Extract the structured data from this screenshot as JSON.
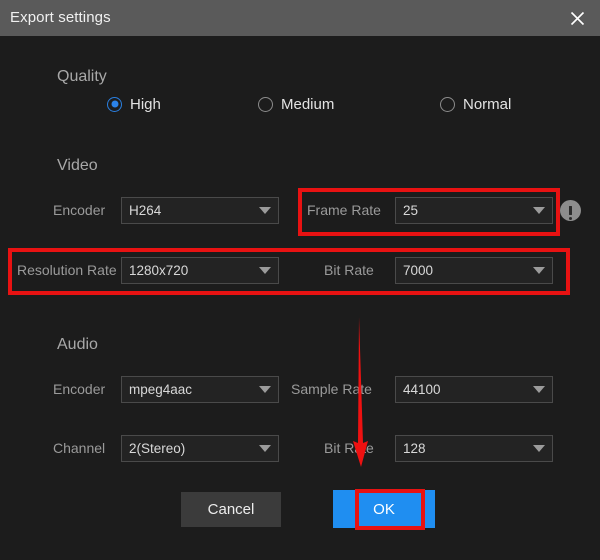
{
  "titlebar": {
    "title": "Export settings",
    "close_icon": "close-icon"
  },
  "quality": {
    "heading": "Quality",
    "options": [
      {
        "label": "High",
        "selected": true
      },
      {
        "label": "Medium",
        "selected": false
      },
      {
        "label": "Normal",
        "selected": false
      }
    ]
  },
  "video": {
    "heading": "Video",
    "encoder": {
      "label": "Encoder",
      "value": "H264"
    },
    "frame_rate": {
      "label": "Frame Rate",
      "value": "25"
    },
    "resolution_rate": {
      "label": "Resolution Rate",
      "value": "1280x720"
    },
    "bit_rate": {
      "label": "Bit Rate",
      "value": "7000"
    },
    "info_icon": "info-exclamation-icon"
  },
  "audio": {
    "heading": "Audio",
    "encoder": {
      "label": "Encoder",
      "value": "mpeg4aac"
    },
    "sample_rate": {
      "label": "Sample Rate",
      "value": "44100"
    },
    "channel": {
      "label": "Channel",
      "value": "2(Stereo)"
    },
    "bit_rate": {
      "label": "Bit Rate",
      "value": "128"
    }
  },
  "footer": {
    "cancel_label": "Cancel",
    "ok_label": "OK"
  },
  "annotations": {
    "highlight_color": "#e81212",
    "arrow_color": "#ee1111",
    "boxes": [
      "frame-rate-field",
      "resolution-rate-row",
      "ok-button"
    ],
    "arrow": "points-down-to-ok-button"
  },
  "colors": {
    "titlebar_bg": "#5a5a5a",
    "dialog_bg": "#1c1c1c",
    "accent_blue": "#1f8ef1",
    "radio_blue": "#2b82e8"
  }
}
